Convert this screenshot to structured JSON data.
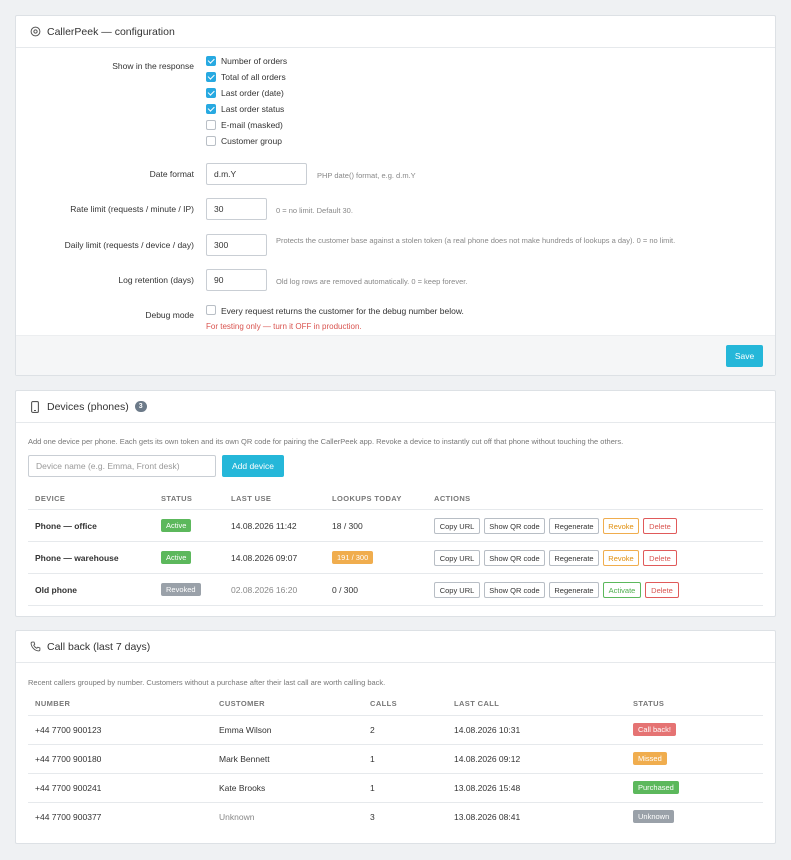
{
  "config": {
    "title": "CallerPeek — configuration",
    "show_label": "Show in the response",
    "options": [
      {
        "label": "Number of orders",
        "checked": true
      },
      {
        "label": "Total of all orders",
        "checked": true
      },
      {
        "label": "Last order (date)",
        "checked": true
      },
      {
        "label": "Last order status",
        "checked": true
      },
      {
        "label": "E-mail (masked)",
        "checked": false
      },
      {
        "label": "Customer group",
        "checked": false
      }
    ],
    "date_format": {
      "label": "Date format",
      "value": "d.m.Y",
      "hint": "PHP date() format, e.g. d.m.Y"
    },
    "rate_limit": {
      "label": "Rate limit (requests / minute / IP)",
      "value": "30",
      "hint": "0 = no limit. Default 30."
    },
    "daily_limit": {
      "label": "Daily limit (requests / device / day)",
      "value": "300",
      "hint": "Protects the customer base against a stolen token (a real phone does not make hundreds of lookups a day). 0 = no limit."
    },
    "log_retention": {
      "label": "Log retention (days)",
      "value": "90",
      "hint": "Old log rows are removed automatically. 0 = keep forever."
    },
    "debug": {
      "label": "Debug mode",
      "checked": false,
      "text": "Every request returns the customer for the debug number below.",
      "warning": "For testing only — turn it OFF in production."
    },
    "save_label": "Save"
  },
  "devices": {
    "title": "Devices (phones)",
    "count": "3",
    "description": "Add one device per phone. Each gets its own token and its own QR code for pairing the CallerPeek app. Revoke a device to instantly cut off that phone without touching the others.",
    "input_placeholder": "Device name (e.g. Emma, Front desk)",
    "add_label": "Add device",
    "columns": [
      "DEVICE",
      "STATUS",
      "LAST USE",
      "LOOKUPS TODAY",
      "ACTIONS"
    ],
    "rows": [
      {
        "name": "Phone — office",
        "status": "Active",
        "last_use": "14.08.2026 11:42",
        "lookups": "18 / 300",
        "lookups_warn": false,
        "toggle": "Revoke"
      },
      {
        "name": "Phone — warehouse",
        "status": "Active",
        "last_use": "14.08.2026 09:07",
        "lookups": "191 / 300",
        "lookups_warn": true,
        "toggle": "Revoke"
      },
      {
        "name": "Old phone",
        "status": "Revoked",
        "last_use": "02.08.2026 16:20",
        "lookups": "0 / 300",
        "lookups_warn": false,
        "toggle": "Activate"
      }
    ],
    "actions": {
      "copy": "Copy URL",
      "qr": "Show QR code",
      "regen": "Regenerate",
      "delete": "Delete"
    }
  },
  "callback": {
    "title": "Call back (last 7 days)",
    "description": "Recent callers grouped by number. Customers without a purchase after their last call are worth calling back.",
    "columns": [
      "NUMBER",
      "CUSTOMER",
      "CALLS",
      "LAST CALL",
      "STATUS"
    ],
    "rows": [
      {
        "number": "+44 7700 900123",
        "customer": "Emma Wilson",
        "calls": "2",
        "last_call": "14.08.2026 10:31",
        "status": "Call back!",
        "status_color": "#e57373"
      },
      {
        "number": "+44 7700 900180",
        "customer": "Mark Bennett",
        "calls": "1",
        "last_call": "14.08.2026 09:12",
        "status": "Missed",
        "status_color": "#f0ad4e"
      },
      {
        "number": "+44 7700 900241",
        "customer": "Kate Brooks",
        "calls": "1",
        "last_call": "13.08.2026 15:48",
        "status": "Purchased",
        "status_color": "#5cb85c"
      },
      {
        "number": "+44 7700 900377",
        "customer": "Unknown",
        "calls": "3",
        "last_call": "13.08.2026 08:41",
        "status": "Unknown",
        "status_color": "#9aa1a9"
      }
    ]
  }
}
